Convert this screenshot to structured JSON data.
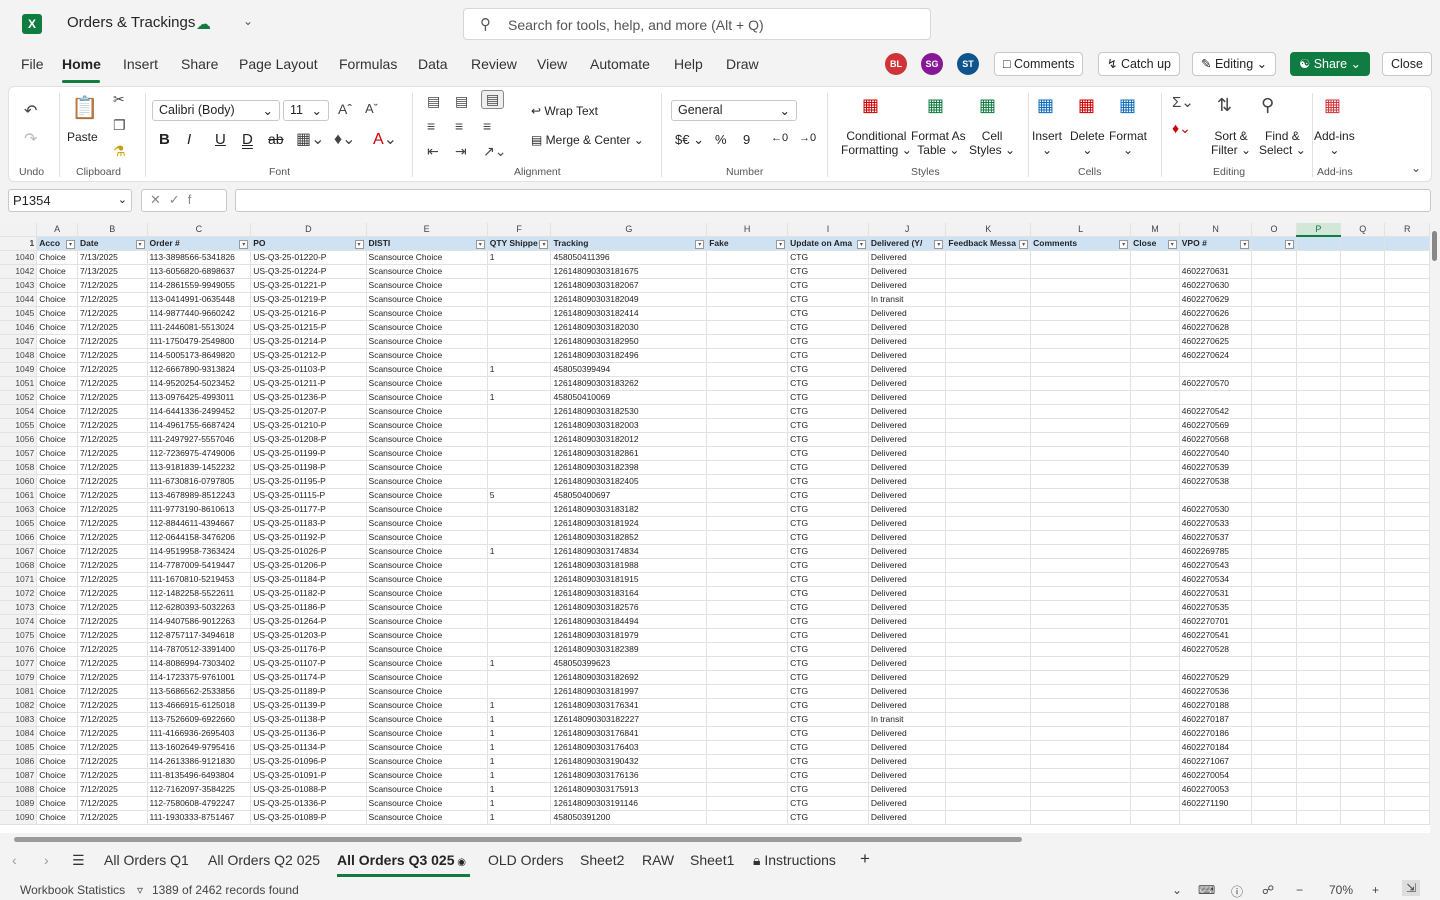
{
  "app": {
    "icon_letter": "X",
    "title": "Orders & Trackings",
    "search_placeholder": "Search for tools, help, and more (Alt + Q)"
  },
  "menu": [
    "File",
    "Home",
    "Insert",
    "Share",
    "Page Layout",
    "Formulas",
    "Data",
    "Review",
    "View",
    "Automate",
    "Help",
    "Draw"
  ],
  "avatars": [
    {
      "initials": "BL",
      "color": "#d13438"
    },
    {
      "initials": "SG",
      "color": "#881798"
    },
    {
      "initials": "ST",
      "color": "#0f548c"
    }
  ],
  "header_buttons": {
    "comments": "Comments",
    "catchup": "Catch up",
    "editing": "Editing",
    "share": "Share",
    "close": "Close"
  },
  "ribbon": {
    "undo_group": "Undo",
    "clipboard": {
      "paste": "Paste",
      "group": "Clipboard"
    },
    "font": {
      "name": "Calibri (Body)",
      "size": "11",
      "group": "Font"
    },
    "alignment": {
      "wrap": "Wrap Text",
      "merge": "Merge & Center",
      "group": "Alignment"
    },
    "number": {
      "format": "General",
      "group": "Number"
    },
    "styles": {
      "conditional": [
        "Conditional",
        "Formatting"
      ],
      "format_table": [
        "Format As",
        "Table"
      ],
      "cell_styles": [
        "Cell",
        "Styles"
      ],
      "group": "Styles"
    },
    "cells": {
      "insert": "Insert",
      "delete": "Delete",
      "format": "Format",
      "group": "Cells"
    },
    "editing": {
      "sort": [
        "Sort &",
        "Filter"
      ],
      "find": [
        "Find &",
        "Select"
      ],
      "group": "Editing"
    },
    "addins": {
      "label": "Add-ins",
      "group": "Add-ins"
    }
  },
  "formula_bar": {
    "name_box": "P1354",
    "formula": ""
  },
  "columns": [
    "A",
    "B",
    "C",
    "D",
    "E",
    "F",
    "G",
    "H",
    "I",
    "J",
    "K",
    "L",
    "M",
    "N",
    "O",
    "P",
    "Q",
    "R"
  ],
  "headers": [
    "Acco",
    "Date",
    "Order #",
    "PO",
    "DISTI",
    "QTY Shippe",
    "Tracking",
    "Fake",
    "Update on Ama",
    "Delivered (Y/",
    "Feedback Messa",
    "Comments",
    "Close",
    "VPO #",
    "",
    "",
    "",
    ""
  ],
  "rows": [
    [
      "1040",
      "Choice",
      "7/13/2025",
      "113-3898566-5341826",
      "US-Q3-25-01220-P",
      "Scansource Choice",
      "1",
      "458050411396",
      "",
      "CTG",
      "Delivered",
      "",
      "",
      "",
      ""
    ],
    [
      "1042",
      "Choice",
      "7/13/2025",
      "113-6056820-6898637",
      "US-Q3-25-01224-P",
      "Scansource Choice",
      "",
      "126148090303181675",
      "",
      "CTG",
      "Delivered",
      "",
      "",
      "",
      "4602270631"
    ],
    [
      "1043",
      "Choice",
      "7/12/2025",
      "114-2861559-9949055",
      "US-Q3-25-01221-P",
      "Scansource Choice",
      "",
      "126148090303182067",
      "",
      "CTG",
      "Delivered",
      "",
      "",
      "",
      "4602270630"
    ],
    [
      "1044",
      "Choice",
      "7/12/2025",
      "113-0414991-0635448",
      "US-Q3-25-01219-P",
      "Scansource Choice",
      "",
      "126148090303182049",
      "",
      "CTG",
      "In transit",
      "",
      "",
      "",
      "4602270629"
    ],
    [
      "1045",
      "Choice",
      "7/12/2025",
      "114-9877440-9660242",
      "US-Q3-25-01216-P",
      "Scansource Choice",
      "",
      "126148090303182414",
      "",
      "CTG",
      "Delivered",
      "",
      "",
      "",
      "4602270626"
    ],
    [
      "1046",
      "Choice",
      "7/12/2025",
      "111-2446081-5513024",
      "US-Q3-25-01215-P",
      "Scansource Choice",
      "",
      "126148090303182030",
      "",
      "CTG",
      "Delivered",
      "",
      "",
      "",
      "4602270628"
    ],
    [
      "1047",
      "Choice",
      "7/12/2025",
      "111-1750479-2549800",
      "US-Q3-25-01214-P",
      "Scansource Choice",
      "",
      "126148090303182950",
      "",
      "CTG",
      "Delivered",
      "",
      "",
      "",
      "4602270625"
    ],
    [
      "1048",
      "Choice",
      "7/12/2025",
      "114-5005173-8649820",
      "US-Q3-25-01212-P",
      "Scansource Choice",
      "",
      "126148090303182496",
      "",
      "CTG",
      "Delivered",
      "",
      "",
      "",
      "4602270624"
    ],
    [
      "1049",
      "Choice",
      "7/12/2025",
      "112-6667890-9313824",
      "US-Q3-25-01103-P",
      "Scansource Choice",
      "1",
      "458050399494",
      "",
      "CTG",
      "Delivered",
      "",
      "",
      "",
      ""
    ],
    [
      "1051",
      "Choice",
      "7/12/2025",
      "114-9520254-5023452",
      "US-Q3-25-01211-P",
      "Scansource Choice",
      "",
      "126148090303183262",
      "",
      "CTG",
      "Delivered",
      "",
      "",
      "",
      "4602270570"
    ],
    [
      "1052",
      "Choice",
      "7/12/2025",
      "113-0976425-4993011",
      "US-Q3-25-01236-P",
      "Scansource Choice",
      "1",
      "458050410069",
      "",
      "CTG",
      "Delivered",
      "",
      "",
      "",
      ""
    ],
    [
      "1054",
      "Choice",
      "7/12/2025",
      "114-6441336-2499452",
      "US-Q3-25-01207-P",
      "Scansource Choice",
      "",
      "126148090303182530",
      "",
      "CTG",
      "Delivered",
      "",
      "",
      "",
      "4602270542"
    ],
    [
      "1055",
      "Choice",
      "7/12/2025",
      "114-4961755-6687424",
      "US-Q3-25-01210-P",
      "Scansource Choice",
      "",
      "126148090303182003",
      "",
      "CTG",
      "Delivered",
      "",
      "",
      "",
      "4602270569"
    ],
    [
      "1056",
      "Choice",
      "7/12/2025",
      "111-2497927-5557046",
      "US-Q3-25-01208-P",
      "Scansource Choice",
      "",
      "126148090303182012",
      "",
      "CTG",
      "Delivered",
      "",
      "",
      "",
      "4602270568"
    ],
    [
      "1057",
      "Choice",
      "7/12/2025",
      "112-7236975-4749006",
      "US-Q3-25-01199-P",
      "Scansource Choice",
      "",
      "126148090303182861",
      "",
      "CTG",
      "Delivered",
      "",
      "",
      "",
      "4602270540"
    ],
    [
      "1058",
      "Choice",
      "7/12/2025",
      "113-9181839-1452232",
      "US-Q3-25-01198-P",
      "Scansource Choice",
      "",
      "126148090303182398",
      "",
      "CTG",
      "Delivered",
      "",
      "",
      "",
      "4602270539"
    ],
    [
      "1060",
      "Choice",
      "7/12/2025",
      "111-6730816-0797805",
      "US-Q3-25-01195-P",
      "Scansource Choice",
      "",
      "126148090303182405",
      "",
      "CTG",
      "Delivered",
      "",
      "",
      "",
      "4602270538"
    ],
    [
      "1061",
      "Choice",
      "7/12/2025",
      "113-4678989-8512243",
      "US-Q3-25-01115-P",
      "Scansource Choice",
      "5",
      "458050400697",
      "",
      "CTG",
      "Delivered",
      "",
      "",
      "",
      ""
    ],
    [
      "1063",
      "Choice",
      "7/12/2025",
      "111-9773190-8610613",
      "US-Q3-25-01177-P",
      "Scansource Choice",
      "",
      "126148090303183182",
      "",
      "CTG",
      "Delivered",
      "",
      "",
      "",
      "4602270530"
    ],
    [
      "1065",
      "Choice",
      "7/12/2025",
      "112-8844611-4394667",
      "US-Q3-25-01183-P",
      "Scansource Choice",
      "",
      "126148090303181924",
      "",
      "CTG",
      "Delivered",
      "",
      "",
      "",
      "4602270533"
    ],
    [
      "1066",
      "Choice",
      "7/12/2025",
      "112-0644158-3476206",
      "US-Q3-25-01192-P",
      "Scansource Choice",
      "",
      "126148090303182852",
      "",
      "CTG",
      "Delivered",
      "",
      "",
      "",
      "4602270537"
    ],
    [
      "1067",
      "Choice",
      "7/12/2025",
      "114-9519958-7363424",
      "US-Q3-25-01026-P",
      "Scansource Choice",
      "1",
      "126148090303174834",
      "",
      "CTG",
      "Delivered",
      "",
      "",
      "",
      "4602269785"
    ],
    [
      "1068",
      "Choice",
      "7/12/2025",
      "114-7787009-5419447",
      "US-Q3-25-01206-P",
      "Scansource Choice",
      "",
      "126148090303181988",
      "",
      "CTG",
      "Delivered",
      "",
      "",
      "",
      "4602270543"
    ],
    [
      "1071",
      "Choice",
      "7/12/2025",
      "111-1670810-5219453",
      "US-Q3-25-01184-P",
      "Scansource Choice",
      "",
      "126148090303181915",
      "",
      "CTG",
      "Delivered",
      "",
      "",
      "",
      "4602270534"
    ],
    [
      "1072",
      "Choice",
      "7/12/2025",
      "112-1482258-5522611",
      "US-Q3-25-01182-P",
      "Scansource Choice",
      "",
      "126148090303183164",
      "",
      "CTG",
      "Delivered",
      "",
      "",
      "",
      "4602270531"
    ],
    [
      "1073",
      "Choice",
      "7/12/2025",
      "112-6280393-5032263",
      "US-Q3-25-01186-P",
      "Scansource Choice",
      "",
      "126148090303182576",
      "",
      "CTG",
      "Delivered",
      "",
      "",
      "",
      "4602270535"
    ],
    [
      "1074",
      "Choice",
      "7/12/2025",
      "114-9407586-9012263",
      "US-Q3-25-01264-P",
      "Scansource Choice",
      "",
      "126148090303184494",
      "",
      "CTG",
      "Delivered",
      "",
      "",
      "",
      "4602270701"
    ],
    [
      "1075",
      "Choice",
      "7/12/2025",
      "112-8757117-3494618",
      "US-Q3-25-01203-P",
      "Scansource Choice",
      "",
      "126148090303181979",
      "",
      "CTG",
      "Delivered",
      "",
      "",
      "",
      "4602270541"
    ],
    [
      "1076",
      "Choice",
      "7/12/2025",
      "114-7870512-3391400",
      "US-Q3-25-01176-P",
      "Scansource Choice",
      "",
      "126148090303182389",
      "",
      "CTG",
      "Delivered",
      "",
      "",
      "",
      "4602270528"
    ],
    [
      "1077",
      "Choice",
      "7/12/2025",
      "114-8086994-7303402",
      "US-Q3-25-01107-P",
      "Scansource Choice",
      "1",
      "458050399623",
      "",
      "CTG",
      "Delivered",
      "",
      "",
      "",
      ""
    ],
    [
      "1079",
      "Choice",
      "7/12/2025",
      "114-1723375-9761001",
      "US-Q3-25-01174-P",
      "Scansource Choice",
      "",
      "126148090303182692",
      "",
      "CTG",
      "Delivered",
      "",
      "",
      "",
      "4602270529"
    ],
    [
      "1081",
      "Choice",
      "7/12/2025",
      "113-5686562-2533856",
      "US-Q3-25-01189-P",
      "Scansource Choice",
      "",
      "126148090303181997",
      "",
      "CTG",
      "Delivered",
      "",
      "",
      "",
      "4602270536"
    ],
    [
      "1082",
      "Choice",
      "7/12/2025",
      "113-4666915-6125018",
      "US-Q3-25-01139-P",
      "Scansource Choice",
      "1",
      "126148090303176341",
      "",
      "CTG",
      "Delivered",
      "",
      "",
      "",
      "4602270188"
    ],
    [
      "1083",
      "Choice",
      "7/12/2025",
      "113-7526609-6922660",
      "US-Q3-25-01138-P",
      "Scansource Choice",
      "1",
      "1Z6148090303182227",
      "",
      "CTG",
      "In transit",
      "",
      "",
      "",
      "4602270187"
    ],
    [
      "1084",
      "Choice",
      "7/12/2025",
      "111-4166936-2695403",
      "US-Q3-25-01136-P",
      "Scansource Choice",
      "1",
      "126148090303176841",
      "",
      "CTG",
      "Delivered",
      "",
      "",
      "",
      "4602270186"
    ],
    [
      "1085",
      "Choice",
      "7/12/2025",
      "113-1602649-9795416",
      "US-Q3-25-01134-P",
      "Scansource Choice",
      "1",
      "126148090303176403",
      "",
      "CTG",
      "Delivered",
      "",
      "",
      "",
      "4602270184"
    ],
    [
      "1086",
      "Choice",
      "7/12/2025",
      "114-2613386-9121830",
      "US-Q3-25-01096-P",
      "Scansource Choice",
      "1",
      "126148090303190432",
      "",
      "CTG",
      "Delivered",
      "",
      "",
      "",
      "4602271067"
    ],
    [
      "1087",
      "Choice",
      "7/12/2025",
      "111-8135496-6493804",
      "US-Q3-25-01091-P",
      "Scansource Choice",
      "1",
      "126148090303176136",
      "",
      "CTG",
      "Delivered",
      "",
      "",
      "",
      "4602270054"
    ],
    [
      "1088",
      "Choice",
      "7/12/2025",
      "112-7162097-3584225",
      "US-Q3-25-01088-P",
      "Scansource Choice",
      "1",
      "126148090303175913",
      "",
      "CTG",
      "Delivered",
      "",
      "",
      "",
      "4602270053"
    ],
    [
      "1089",
      "Choice",
      "7/12/2025",
      "112-7580608-4792247",
      "US-Q3-25-01336-P",
      "Scansource Choice",
      "1",
      "126148090303191146",
      "",
      "CTG",
      "Delivered",
      "",
      "",
      "",
      "4602271190"
    ],
    [
      "1090",
      "Choice",
      "7/12/2025",
      "111-1930333-8751467",
      "US-Q3-25-01089-P",
      "Scansource Choice",
      "1",
      "458050391200",
      "",
      "CTG",
      "Delivered",
      "",
      "",
      "",
      ""
    ]
  ],
  "sheets": [
    "All Orders Q1",
    "All Orders Q2 025",
    "All Orders Q3 025",
    "OLD Orders",
    "Sheet2",
    "RAW",
    "Sheet1",
    "Instructions"
  ],
  "status": {
    "workbook": "Workbook Statistics",
    "records": "1389 of 2462 records found",
    "zoom": "70%"
  }
}
